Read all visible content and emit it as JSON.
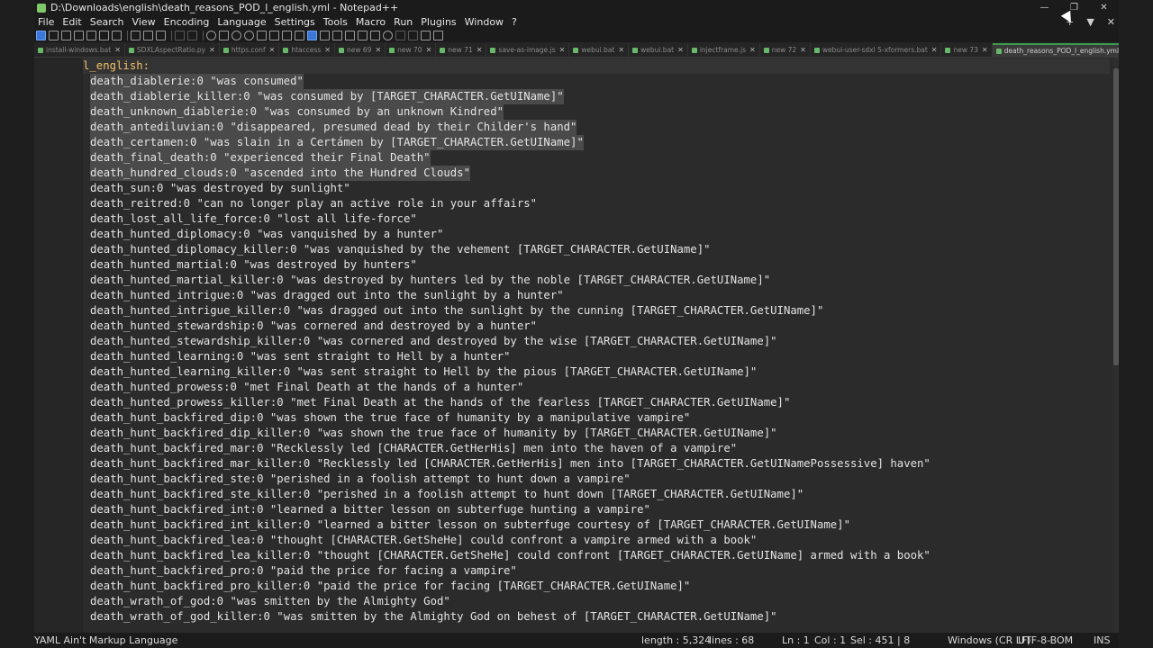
{
  "window": {
    "title": "D:\\Downloads\\english\\death_reasons_POD_l_english.yml - Notepad++",
    "controls": [
      "—",
      "❐",
      "✕"
    ]
  },
  "menu": {
    "items": [
      "File",
      "Edit",
      "Search",
      "View",
      "Encoding",
      "Language",
      "Settings",
      "Tools",
      "Macro",
      "Run",
      "Plugins",
      "Window",
      "?"
    ],
    "right": [
      "+",
      "▼",
      "✕"
    ]
  },
  "tabs": [
    {
      "label": "install-windows.bat"
    },
    {
      "label": "SDXLAspectRatio.py"
    },
    {
      "label": "https.conf"
    },
    {
      "label": "htaccess"
    },
    {
      "label": "new 69"
    },
    {
      "label": "new 70"
    },
    {
      "label": "new 71"
    },
    {
      "label": "save-as-image.js"
    },
    {
      "label": "webui.bat"
    },
    {
      "label": "webui.bat"
    },
    {
      "label": "injectframe.js"
    },
    {
      "label": "new 72"
    },
    {
      "label": "webui-user-sdxl 5-xformers.bat"
    },
    {
      "label": "new 73"
    },
    {
      "label": "death_reasons_POD_l_english.yml",
      "active": true
    }
  ],
  "editor": {
    "lines": [
      "l_english:",
      "death_diablerie:0 \"was consumed\"",
      "death_diablerie_killer:0 \"was consumed by [TARGET_CHARACTER.GetUIName]\"",
      "death_unknown_diablerie:0 \"was consumed by an unknown Kindred\"",
      "death_antediluvian:0 \"disappeared, presumed dead by their Childer's hand\"",
      "death_certamen:0 \"was slain in a Certámen by [TARGET_CHARACTER.GetUIName]\"",
      "death_final_death:0 \"experienced their Final Death\"",
      "death_hundred_clouds:0 \"ascended into the Hundred Clouds\"",
      "death_sun:0 \"was destroyed by sunlight\"",
      "death_reitred:0 \"can no longer play an active role in your affairs\"",
      "death_lost_all_life_force:0 \"lost all life-force\"",
      "death_hunted_diplomacy:0 \"was vanquished by a hunter\"",
      "death_hunted_diplomacy_killer:0 \"was vanquished by the vehement [TARGET_CHARACTER.GetUIName]\"",
      "death_hunted_martial:0 \"was destroyed by hunters\"",
      "death_hunted_martial_killer:0 \"was destroyed by hunters led by the noble [TARGET_CHARACTER.GetUIName]\"",
      "death_hunted_intrigue:0 \"was dragged out into the sunlight by a hunter\"",
      "death_hunted_intrigue_killer:0 \"was dragged out into the sunlight by the cunning [TARGET_CHARACTER.GetUIName]\"",
      "death_hunted_stewardship:0 \"was cornered and destroyed by a hunter\"",
      "death_hunted_stewardship_killer:0 \"was cornered and destroyed by the wise [TARGET_CHARACTER.GetUIName]\"",
      "death_hunted_learning:0 \"was sent straight to Hell by a hunter\"",
      "death_hunted_learning_killer:0 \"was sent straight to Hell by the pious [TARGET_CHARACTER.GetUIName]\"",
      "death_hunted_prowess:0 \"met Final Death at the hands of a hunter\"",
      "death_hunted_prowess_killer:0 \"met Final Death at the hands of the fearless [TARGET_CHARACTER.GetUIName]\"",
      "death_hunt_backfired_dip:0 \"was shown the true face of humanity by a manipulative vampire\"",
      "death_hunt_backfired_dip_killer:0 \"was shown the true face of humanity by [TARGET_CHARACTER.GetUIName]\"",
      "death_hunt_backfired_mar:0 \"Recklessly led [CHARACTER.GetHerHis] men into the haven of a vampire\"",
      "death_hunt_backfired_mar_killer:0 \"Recklessly led [CHARACTER.GetHerHis] men into [TARGET_CHARACTER.GetUINamePossessive] haven\"",
      "death_hunt_backfired_ste:0 \"perished in a foolish attempt to hunt down a vampire\"",
      "death_hunt_backfired_ste_killer:0 \"perished in a foolish attempt to hunt down [TARGET_CHARACTER.GetUIName]\"",
      "death_hunt_backfired_int:0 \"learned a bitter lesson on subterfuge hunting a vampire\"",
      "death_hunt_backfired_int_killer:0 \"learned a bitter lesson on subterfuge courtesy of [TARGET_CHARACTER.GetUIName]\"",
      "death_hunt_backfired_lea:0 \"thought [CHARACTER.GetSheHe] could confront a vampire armed with a book\"",
      "death_hunt_backfired_lea_killer:0 \"thought [CHARACTER.GetSheHe] could confront [TARGET_CHARACTER.GetUIName] armed with a book\"",
      "death_hunt_backfired_pro:0 \"paid the price for facing a vampire\"",
      "death_hunt_backfired_pro_killer:0 \"paid the price for facing [TARGET_CHARACTER.GetUIName]\"",
      "death_wrath_of_god:0 \"was smitten by the Almighty God\"",
      "death_wrath_of_god_killer:0 \"was smitten by the Almighty God on behest of [TARGET_CHARACTER.GetUIName]\""
    ],
    "selected_lines": 8
  },
  "status": {
    "language": "YAML Ain't Markup Language",
    "length": "length : 5,324",
    "lines": "lines : 68",
    "ln": "Ln : 1",
    "col": "Col : 1",
    "sel": "Sel : 451 | 8",
    "eol": "Windows (CR LF)",
    "encoding": "UTF-8-BOM",
    "mode": "INS"
  }
}
